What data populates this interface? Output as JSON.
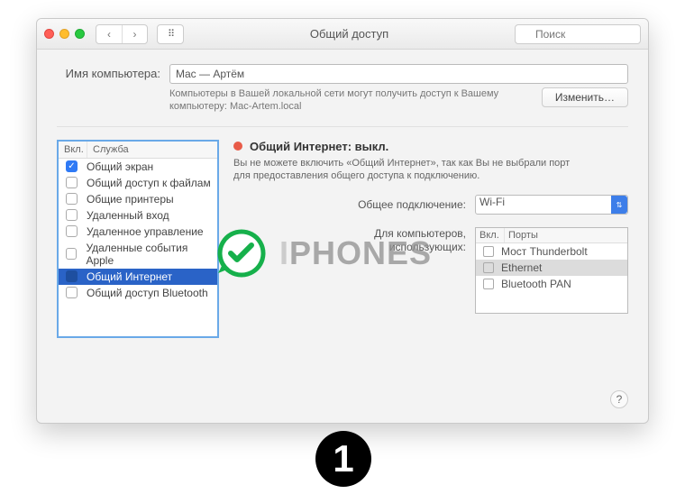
{
  "window": {
    "title": "Общий доступ",
    "search_placeholder": "Поиск"
  },
  "computer_name": {
    "label": "Имя компьютера:",
    "value": "Mac — Артём",
    "desc": "Компьютеры в Вашей локальной сети могут получить доступ к Вашему компьютеру: Mac-Artem.local",
    "edit_btn": "Изменить…"
  },
  "services": {
    "head_on": "Вкл.",
    "head_name": "Служба",
    "items": [
      {
        "label": "Общий экран",
        "checked": true,
        "selected": false
      },
      {
        "label": "Общий доступ к файлам",
        "checked": false,
        "selected": false
      },
      {
        "label": "Общие принтеры",
        "checked": false,
        "selected": false
      },
      {
        "label": "Удаленный вход",
        "checked": false,
        "selected": false
      },
      {
        "label": "Удаленное управление",
        "checked": false,
        "selected": false
      },
      {
        "label": "Удаленные события Apple",
        "checked": false,
        "selected": false
      },
      {
        "label": "Общий Интернет",
        "checked": false,
        "selected": true
      },
      {
        "label": "Общий доступ Bluetooth",
        "checked": false,
        "selected": false
      }
    ]
  },
  "detail": {
    "status_title": "Общий Интернет: выкл.",
    "status_note": "Вы не можете включить «Общий Интернет», так как Вы не выбрали порт для предоставления общего доступа к подключению.",
    "share_from_label": "Общее подключение:",
    "share_from_value": "Wi-Fi",
    "ports_label_1": "Для компьютеров,",
    "ports_label_2": "использующих:",
    "ports_head_on": "Вкл.",
    "ports_head_name": "Порты",
    "ports": [
      {
        "label": "Мост Thunderbolt",
        "checked": false,
        "selected": false
      },
      {
        "label": "Ethernet",
        "checked": false,
        "selected": true
      },
      {
        "label": "Bluetooth PAN",
        "checked": false,
        "selected": false
      }
    ]
  },
  "overlay": {
    "watermark": "IPHONES",
    "step": "1"
  }
}
